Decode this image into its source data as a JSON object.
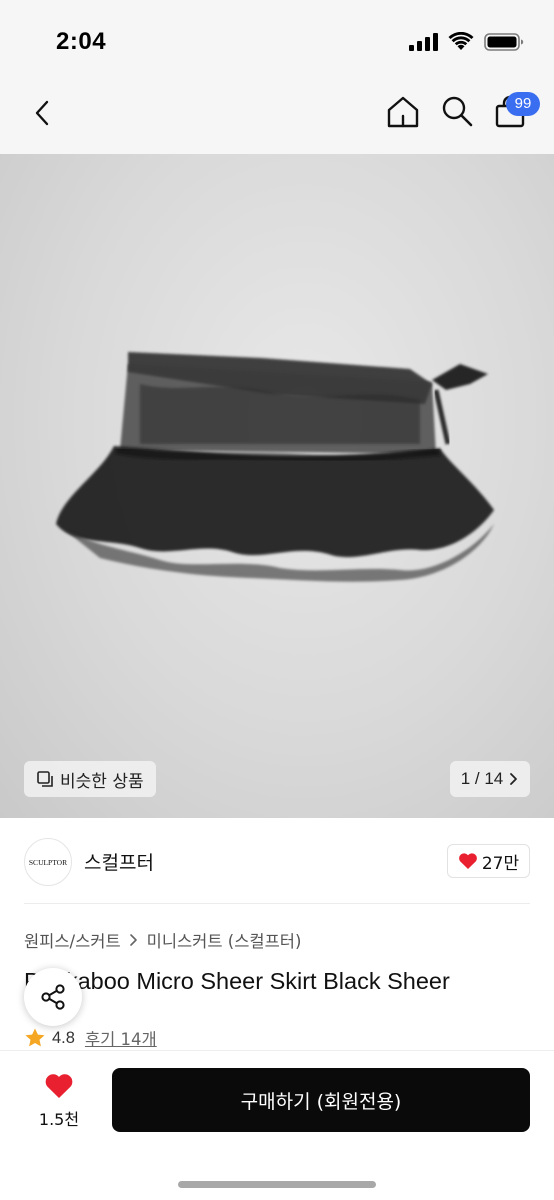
{
  "status": {
    "time": "2:04"
  },
  "nav": {
    "cart_badge": "99"
  },
  "hero": {
    "similar_label": "비슷한 상품",
    "page_current": "1",
    "page_total": "14",
    "page_text": "1 / 14"
  },
  "brand": {
    "logo_text": "SCULPTOR",
    "name": "스컬프터",
    "likes": "27만"
  },
  "product": {
    "breadcrumb": [
      "원피스/스커트",
      "미니스커트 (스컬프터)"
    ],
    "title": "Peekaboo Micro Sheer Skirt Black Sheer",
    "rating": "4.8",
    "reviews": "후기 14개"
  },
  "bottom": {
    "wish_count": "1.5천",
    "buy_label": "구매하기 (회원전용)"
  },
  "colors": {
    "accent_badge": "#3a6ef0",
    "heart": "#e8202f",
    "star": "#f5a623",
    "buy_button": "#0a0a0a"
  }
}
